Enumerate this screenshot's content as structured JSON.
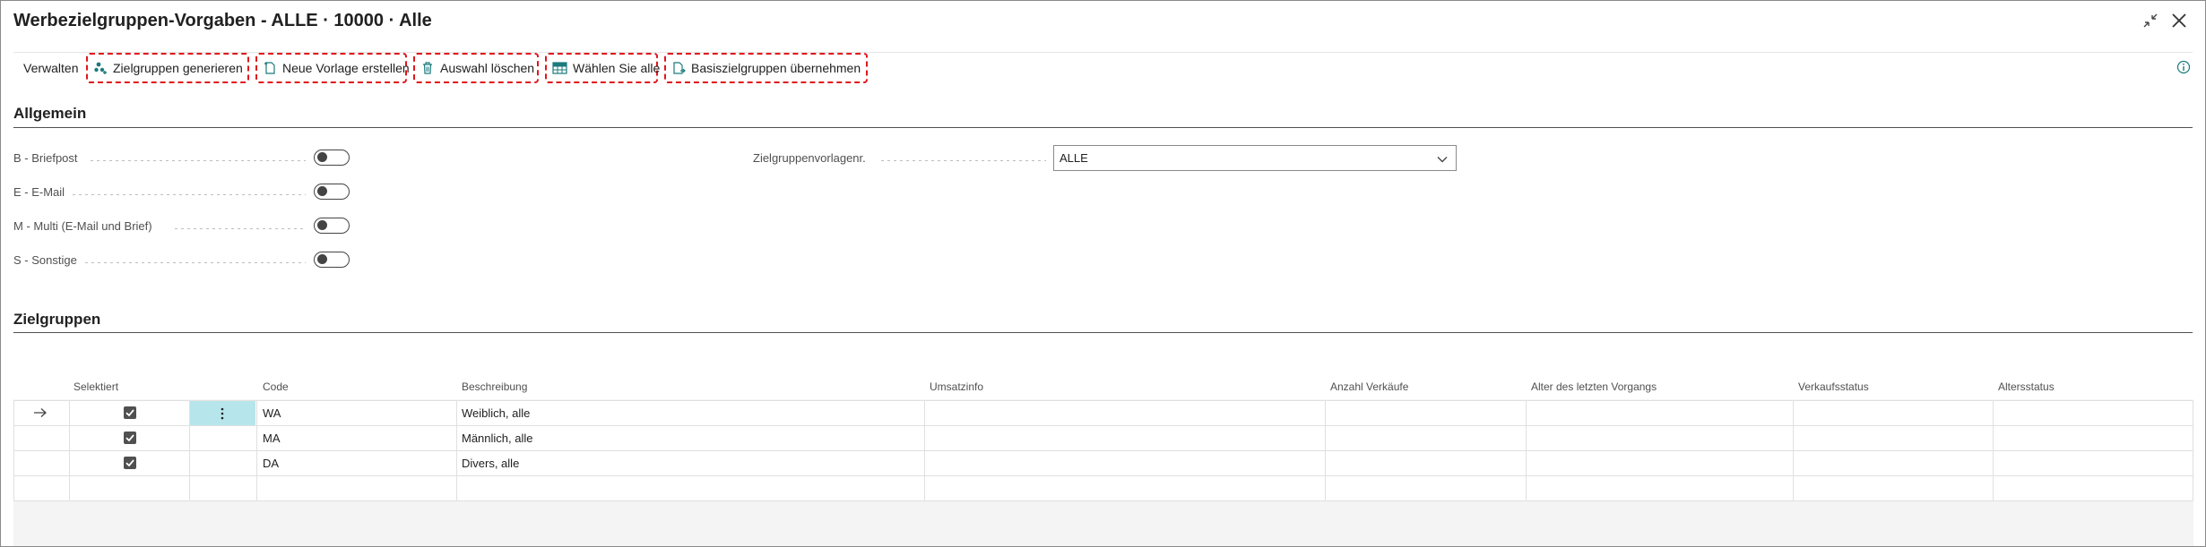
{
  "window": {
    "title": "Werbezielgruppen-Vorgaben - ALLE · 10000 · Alle",
    "collapse_icon": "collapse-arrows-icon",
    "close_icon": "close-icon"
  },
  "toolbar": {
    "manage_label": "Verwalten",
    "actions": [
      {
        "label": "Zielgruppen generieren",
        "icon": "generate-groups-icon"
      },
      {
        "label": "Neue Vorlage erstellen",
        "icon": "new-document-icon"
      },
      {
        "label": "Auswahl löschen",
        "icon": "trash-icon"
      },
      {
        "label": "Wählen Sie alle",
        "icon": "select-all-icon"
      },
      {
        "label": "Basiszielgruppen übernehmen",
        "icon": "import-document-icon"
      }
    ],
    "highlight_color": "#e0161d",
    "info_icon": "info-icon"
  },
  "general": {
    "title": "Allgemein",
    "toggles": [
      {
        "label": "B - Briefpost",
        "value": false
      },
      {
        "label": "E - E-Mail",
        "value": false
      },
      {
        "label": "M - Multi (E-Mail und Brief)",
        "value": false
      },
      {
        "label": "S - Sonstige",
        "value": false
      }
    ],
    "template_no": {
      "label": "Zielgruppenvorlagenr.",
      "value": "ALLE"
    }
  },
  "groups": {
    "title": "Zielgruppen",
    "columns": [
      "Selektiert",
      "Code",
      "Beschreibung",
      "Umsatzinfo",
      "Anzahl Verkäufe",
      "Alter des letzten Vorgangs",
      "Verkaufsstatus",
      "Altersstatus"
    ],
    "rows": [
      {
        "selected": true,
        "code": "WA",
        "description": "Weiblich, alle",
        "current": true
      },
      {
        "selected": true,
        "code": "MA",
        "description": "Männlich, alle",
        "current": false
      },
      {
        "selected": true,
        "code": "DA",
        "description": "Divers, alle",
        "current": false
      }
    ],
    "selected_cell_color": "#b6e6ec"
  }
}
